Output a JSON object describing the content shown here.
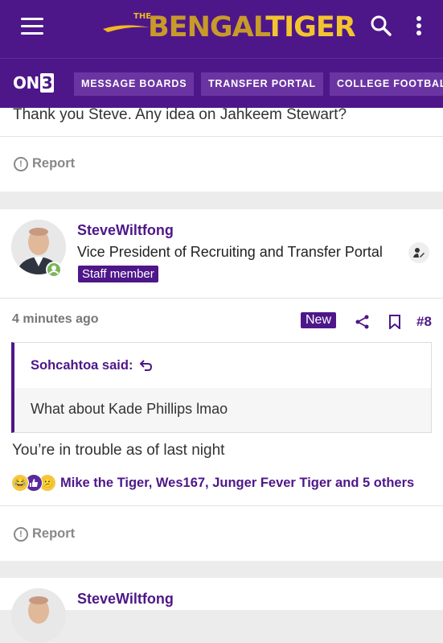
{
  "header": {
    "logo_the": "THE",
    "logo_bengal": "BENGAL",
    "logo_tiger": "TIGER"
  },
  "nav": {
    "brand": "ON",
    "brand_num": "3",
    "tabs": [
      "MESSAGE BOARDS",
      "TRANSFER PORTAL",
      "COLLEGE FOOTBALL"
    ]
  },
  "prev_post": {
    "text": "Thank you Steve. Any idea on Jahkeem Stewart?",
    "report_label": "Report"
  },
  "post": {
    "username": "SteveWiltfong",
    "user_title": "Vice President of Recruiting and Transfer Portal",
    "staff_badge": "Staff member",
    "time": "4 minutes ago",
    "new_label": "New",
    "post_number": "#8",
    "quote_author": "Sohcahtoa said:",
    "quote_text": "What about Kade Phillips lmao",
    "body": "You’re in trouble as of last night",
    "reactions_text": "Mike the Tiger, Wes167, Junger Fever Tiger and 5 others",
    "report_label": "Report"
  },
  "next_post": {
    "username": "SteveWiltfong"
  },
  "colors": {
    "brand_purple": "#4e1789",
    "brand_gold": "#f2b821"
  },
  "icons": [
    "menu-icon",
    "search-icon",
    "kebab-icon",
    "report-icon",
    "share-icon",
    "bookmark-icon",
    "reply-arrow-icon",
    "online-status-icon",
    "staff-badge-icon"
  ]
}
